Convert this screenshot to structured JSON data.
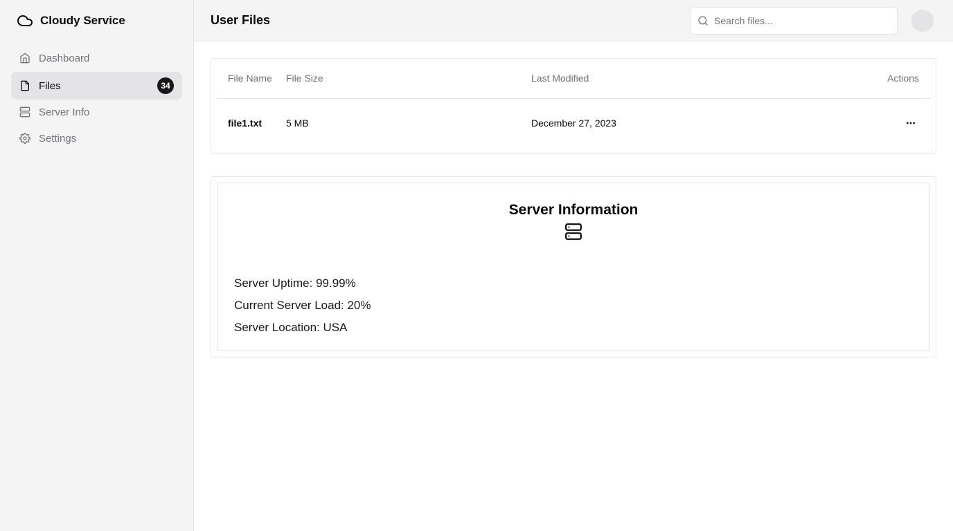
{
  "brand": {
    "name": "Cloudy Service",
    "icon": "cloud-icon"
  },
  "sidebar": {
    "items": [
      {
        "label": "Dashboard",
        "icon": "home-icon",
        "active": false
      },
      {
        "label": "Files",
        "icon": "file-icon",
        "active": true,
        "badge": "34"
      },
      {
        "label": "Server Info",
        "icon": "server-icon",
        "active": false
      },
      {
        "label": "Settings",
        "icon": "gear-icon",
        "active": false
      }
    ]
  },
  "header": {
    "title": "User Files",
    "search": {
      "placeholder": "Search files...",
      "value": ""
    }
  },
  "files_table": {
    "columns": [
      "File Name",
      "File Size",
      "Last Modified",
      "Actions"
    ],
    "rows": [
      {
        "name": "file1.txt",
        "size": "5 MB",
        "modified": "December 27, 2023",
        "actions_icon": "more-horizontal-icon"
      }
    ]
  },
  "server_info": {
    "title": "Server Information",
    "icon": "server-icon",
    "stats": [
      "Server Uptime: 99.99%",
      "Current Server Load: 20%",
      "Server Location: USA"
    ]
  },
  "colors": {
    "sidebar_bg": "#f4f4f5",
    "active_bg": "#e4e4e7",
    "border": "#e4e4e7",
    "muted_text": "#71717a",
    "badge_bg": "#18181b"
  }
}
